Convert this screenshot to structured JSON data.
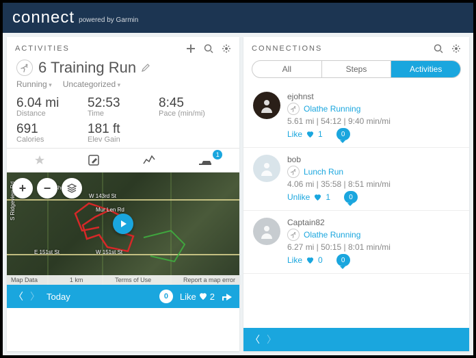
{
  "header": {
    "logo": "connect",
    "sub": "powered by Garmin"
  },
  "activities": {
    "panel_title": "ACTIVITIES",
    "title": "6 Training Run",
    "tags": {
      "type": "Running",
      "category": "Uncategorized"
    },
    "stats": {
      "distance": {
        "value": "6.04 mi",
        "label": "Distance"
      },
      "time": {
        "value": "52:53",
        "label": "Time"
      },
      "pace": {
        "value": "8:45",
        "label": "Pace (min/mi)"
      },
      "calories": {
        "value": "691",
        "label": "Calories"
      },
      "elev": {
        "value": "181 ft",
        "label": "Elev Gain"
      }
    },
    "tab_badge": "1",
    "map": {
      "streets": [
        "S Ridgeview Rd",
        "S Sheridan",
        "W 143rd St",
        "Mur Len Rd",
        "E 151st St",
        "W 151st St"
      ],
      "footer": {
        "data": "Map Data",
        "scale": "1 km",
        "terms": "Terms of Use",
        "report": "Report a map error"
      }
    },
    "foot": {
      "today": "Today",
      "comments": "0",
      "like_label": "Like",
      "like_count": "2"
    }
  },
  "connections": {
    "panel_title": "CONNECTIONS",
    "segments": {
      "all": "All",
      "steps": "Steps",
      "activities": "Activities"
    },
    "items": [
      {
        "name": "ejohnst",
        "activity": "Olathe Running",
        "stats": "5.61 mi | 54:12 | 9:40 min/mi",
        "like_label": "Like",
        "like_count": "1",
        "comments": "0",
        "avatar_bg": "#2a1f18"
      },
      {
        "name": "bob",
        "activity": "Lunch Run",
        "stats": "4.06 mi | 35:58 | 8:51 min/mi",
        "like_label": "Unlike",
        "like_count": "1",
        "comments": "0",
        "avatar_bg": "#d9e4ea"
      },
      {
        "name": "Captain82",
        "activity": "Olathe Running",
        "stats": "6.27 mi | 50:15 | 8:01 min/mi",
        "like_label": "Like",
        "like_count": "0",
        "comments": "0",
        "avatar_bg": "#c7ccd0"
      }
    ]
  }
}
